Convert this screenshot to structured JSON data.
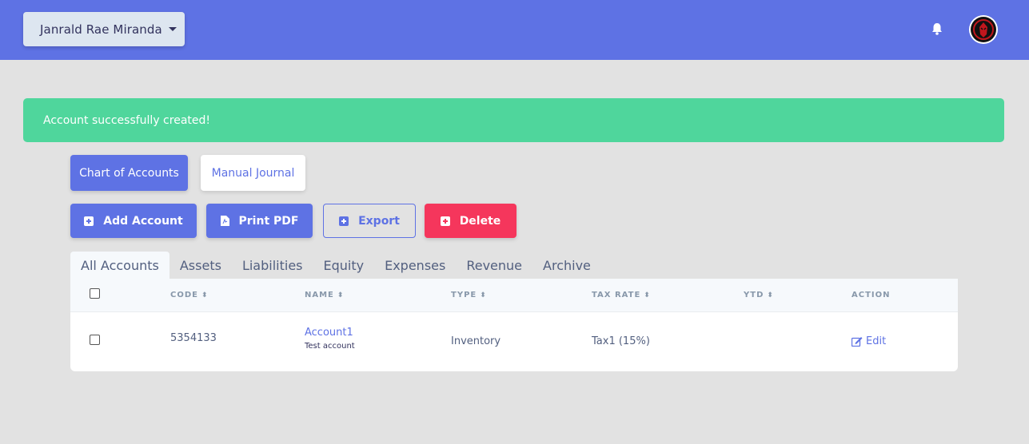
{
  "header": {
    "user_name": "Janrald Rae Miranda",
    "icons": [
      "bell-icon",
      "avatar"
    ]
  },
  "alert": {
    "message": "Account successfully created!"
  },
  "section_tabs": [
    {
      "label": "Chart of Accounts",
      "active": true
    },
    {
      "label": "Manual Journal",
      "active": false
    }
  ],
  "actions": {
    "add": "Add Account",
    "print": "Print PDF",
    "export": "Export",
    "delete": "Delete"
  },
  "filter_tabs": [
    "All Accounts",
    "Assets",
    "Liabilities",
    "Equity",
    "Expenses",
    "Revenue",
    "Archive"
  ],
  "table": {
    "headers": {
      "code": "CODE",
      "name": "NAME",
      "type": "TYPE",
      "tax_rate": "TAX RATE",
      "ytd": "YTD",
      "action": "ACTION"
    },
    "rows": [
      {
        "code": "5354133",
        "name": "Account1",
        "description": "Test account",
        "type": "Inventory",
        "tax_rate": "Tax1 (15%)",
        "ytd": "",
        "action": "Edit"
      }
    ]
  },
  "colors": {
    "primary": "#5e72e4",
    "success": "#4fd69c",
    "danger": "#f5365c",
    "background": "#e2e2e2"
  }
}
